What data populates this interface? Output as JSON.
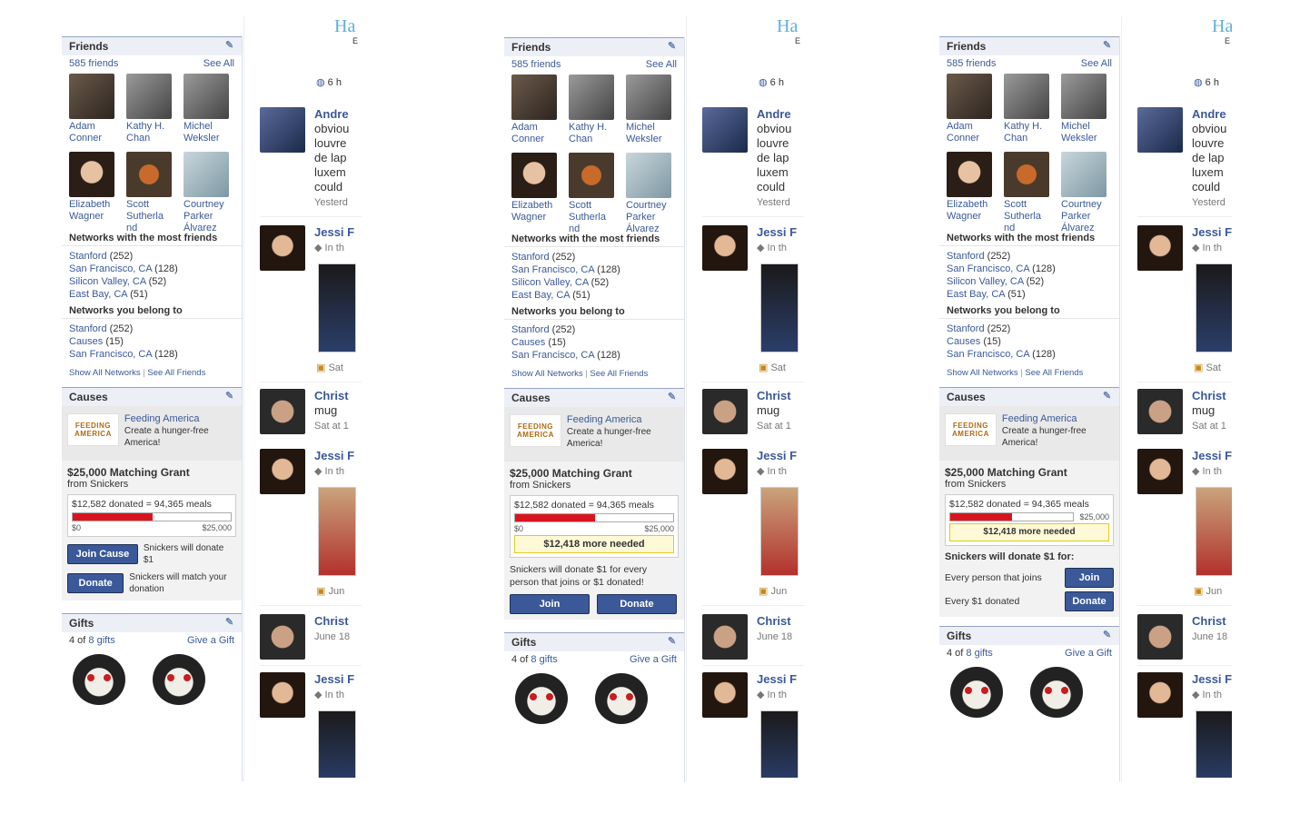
{
  "variants": [
    {
      "friends": {
        "title": "Friends",
        "count": "585 friends",
        "see_all": "See All",
        "people": [
          {
            "name1": "Adam",
            "name2": "Conner",
            "name3": ""
          },
          {
            "name1": "Kathy H.",
            "name2": "Chan",
            "name3": ""
          },
          {
            "name1": "Michel",
            "name2": "Weksler",
            "name3": ""
          },
          {
            "name1": "Elizabeth",
            "name2": "Wagner",
            "name3": ""
          },
          {
            "name1": "Scott",
            "name2": "Sutherla",
            "name3": "nd"
          },
          {
            "name1": "Courtney",
            "name2": "Parker",
            "name3": "Álvarez"
          }
        ],
        "networks_most_title": "Networks with the most friends",
        "networks_most": [
          {
            "name": "Stanford",
            "count": "(252)"
          },
          {
            "name": "San Francisco, CA",
            "count": "(128)"
          },
          {
            "name": "Silicon Valley, CA",
            "count": "(52)"
          },
          {
            "name": "East Bay, CA",
            "count": "(51)"
          }
        ],
        "networks_belong_title": "Networks you belong to",
        "networks_belong": [
          {
            "name": "Stanford",
            "count": "(252)"
          },
          {
            "name": "Causes",
            "count": "(15)"
          },
          {
            "name": "San Francisco, CA",
            "count": "(128)"
          }
        ],
        "show_all_networks": "Show All Networks",
        "see_all_friends": "See All Friends",
        "sep": "|"
      },
      "causes": {
        "title": "Causes",
        "logo_line1": "FEEDING",
        "logo_line2": "AMERICA",
        "cause_name": "Feeding America",
        "cause_desc": "Create a hunger-free America!",
        "grant_title": "$25,000 Matching Grant",
        "grant_sub": "from Snickers",
        "donated_line": "$12,582 donated = 94,365 meals",
        "progress": 0.5033,
        "scale_min": "$0",
        "scale_max": "$25,000",
        "join_label": "Join Cause",
        "join_note": "Snickers will donate $1",
        "donate_label": "Donate",
        "donate_note": "Snickers will match your donation"
      },
      "gifts": {
        "title": "Gifts",
        "count_prefix": "4 of",
        "count_link": "8 gifts",
        "give": "Give a Gift"
      }
    },
    {
      "friends": {
        "title": "Friends",
        "count": "585 friends",
        "see_all": "See All",
        "people": [
          {
            "name1": "Adam",
            "name2": "Conner",
            "name3": ""
          },
          {
            "name1": "Kathy H.",
            "name2": "Chan",
            "name3": ""
          },
          {
            "name1": "Michel",
            "name2": "Weksler",
            "name3": ""
          },
          {
            "name1": "Elizabeth",
            "name2": "Wagner",
            "name3": ""
          },
          {
            "name1": "Scott",
            "name2": "Sutherla",
            "name3": "nd"
          },
          {
            "name1": "Courtney",
            "name2": "Parker",
            "name3": "Álvarez"
          }
        ],
        "networks_most_title": "Networks with the most friends",
        "networks_most": [
          {
            "name": "Stanford",
            "count": "(252)"
          },
          {
            "name": "San Francisco, CA",
            "count": "(128)"
          },
          {
            "name": "Silicon Valley, CA",
            "count": "(52)"
          },
          {
            "name": "East Bay, CA",
            "count": "(51)"
          }
        ],
        "networks_belong_title": "Networks you belong to",
        "networks_belong": [
          {
            "name": "Stanford",
            "count": "(252)"
          },
          {
            "name": "Causes",
            "count": "(15)"
          },
          {
            "name": "San Francisco, CA",
            "count": "(128)"
          }
        ],
        "show_all_networks": "Show All Networks",
        "see_all_friends": "See All Friends",
        "sep": "|"
      },
      "causes": {
        "title": "Causes",
        "logo_line1": "FEEDING",
        "logo_line2": "AMERICA",
        "cause_name": "Feeding America",
        "cause_desc": "Create a hunger-free America!",
        "grant_title": "$25,000 Matching Grant",
        "grant_sub": "from Snickers",
        "donated_line": "$12,582 donated = 94,365 meals",
        "progress": 0.5033,
        "scale_min": "$0",
        "scale_max": "$25,000",
        "needed": "$12,418 more needed",
        "note": "Snickers will donate $1 for every person that joins or $1 donated!",
        "join_label": "Join",
        "donate_label": "Donate"
      },
      "gifts": {
        "title": "Gifts",
        "count_prefix": "4 of",
        "count_link": "8 gifts",
        "give": "Give a Gift"
      }
    },
    {
      "friends": {
        "title": "Friends",
        "count": "585 friends",
        "see_all": "See All",
        "people": [
          {
            "name1": "Adam",
            "name2": "Conner",
            "name3": ""
          },
          {
            "name1": "Kathy H.",
            "name2": "Chan",
            "name3": ""
          },
          {
            "name1": "Michel",
            "name2": "Weksler",
            "name3": ""
          },
          {
            "name1": "Elizabeth",
            "name2": "Wagner",
            "name3": ""
          },
          {
            "name1": "Scott",
            "name2": "Sutherla",
            "name3": "nd"
          },
          {
            "name1": "Courtney",
            "name2": "Parker",
            "name3": "Álvarez"
          }
        ],
        "networks_most_title": "Networks with the most friends",
        "networks_most": [
          {
            "name": "Stanford",
            "count": "(252)"
          },
          {
            "name": "San Francisco, CA",
            "count": "(128)"
          },
          {
            "name": "Silicon Valley, CA",
            "count": "(52)"
          },
          {
            "name": "East Bay, CA",
            "count": "(51)"
          }
        ],
        "networks_belong_title": "Networks you belong to",
        "networks_belong": [
          {
            "name": "Stanford",
            "count": "(252)"
          },
          {
            "name": "Causes",
            "count": "(15)"
          },
          {
            "name": "San Francisco, CA",
            "count": "(128)"
          }
        ],
        "show_all_networks": "Show All Networks",
        "see_all_friends": "See All Friends",
        "sep": "|"
      },
      "causes": {
        "title": "Causes",
        "logo_line1": "FEEDING",
        "logo_line2": "AMERICA",
        "cause_name": "Feeding America",
        "cause_desc": "Create a hunger-free America!",
        "grant_title": "$25,000 Matching Grant",
        "grant_sub": "from Snickers",
        "donated_line": "$12,582 donated = 94,365 meals",
        "progress": 0.5033,
        "scale_max": "$25,000",
        "needed": "$12,418 more needed",
        "intro": "Snickers will donate $1 for:",
        "row1": "Every person that joins",
        "join_label": "Join",
        "row2": "Every $1 donated",
        "donate_label": "Donate"
      },
      "gifts": {
        "title": "Gifts",
        "count_prefix": "4 of",
        "count_link": "8 gifts",
        "give": "Give a Gift"
      }
    }
  ],
  "feed": {
    "logo": "Ha",
    "logo_sub": "E",
    "ticker": "6 h",
    "items": [
      {
        "name": "Andre",
        "lines": [
          "obviou",
          "louvre",
          "de lap",
          "luxem",
          "could"
        ],
        "meta": "Yesterd"
      },
      {
        "name": "Jessi F",
        "lines": [],
        "meta": "In th",
        "photo_meta": "Sat"
      },
      {
        "name": "Christ",
        "lines": [
          "mug"
        ],
        "meta": "Sat at 1"
      },
      {
        "name": "Jessi F",
        "lines": [],
        "meta": "In th",
        "photo_meta": "Jun"
      },
      {
        "name": "Christ",
        "lines": [],
        "meta": "June 18"
      },
      {
        "name": "Jessi F",
        "lines": [],
        "meta": "In th"
      }
    ]
  }
}
